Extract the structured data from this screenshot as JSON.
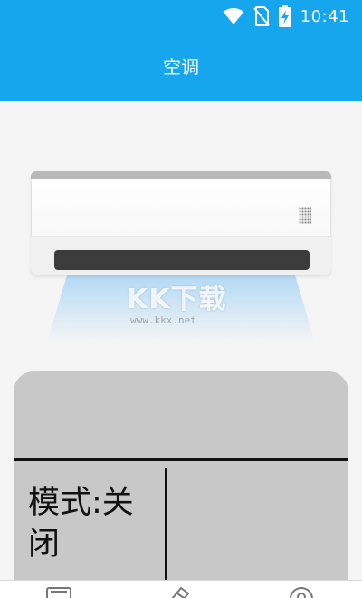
{
  "status_bar": {
    "time": "10:41",
    "icons": [
      "wifi-icon",
      "no-sim-icon",
      "battery-charging-icon"
    ]
  },
  "header": {
    "title": "空调"
  },
  "watermark": {
    "logo": "KK下载",
    "url": "www.kkx.net"
  },
  "control_panel": {
    "mode_text": "模式:关闭"
  },
  "bottom_nav": {
    "icons": [
      "remote-icon",
      "brush-icon",
      "profile-icon"
    ]
  },
  "colors": {
    "accent": "#16a6ee",
    "panel": "#c8c8c8",
    "background": "#f5f5f5"
  }
}
